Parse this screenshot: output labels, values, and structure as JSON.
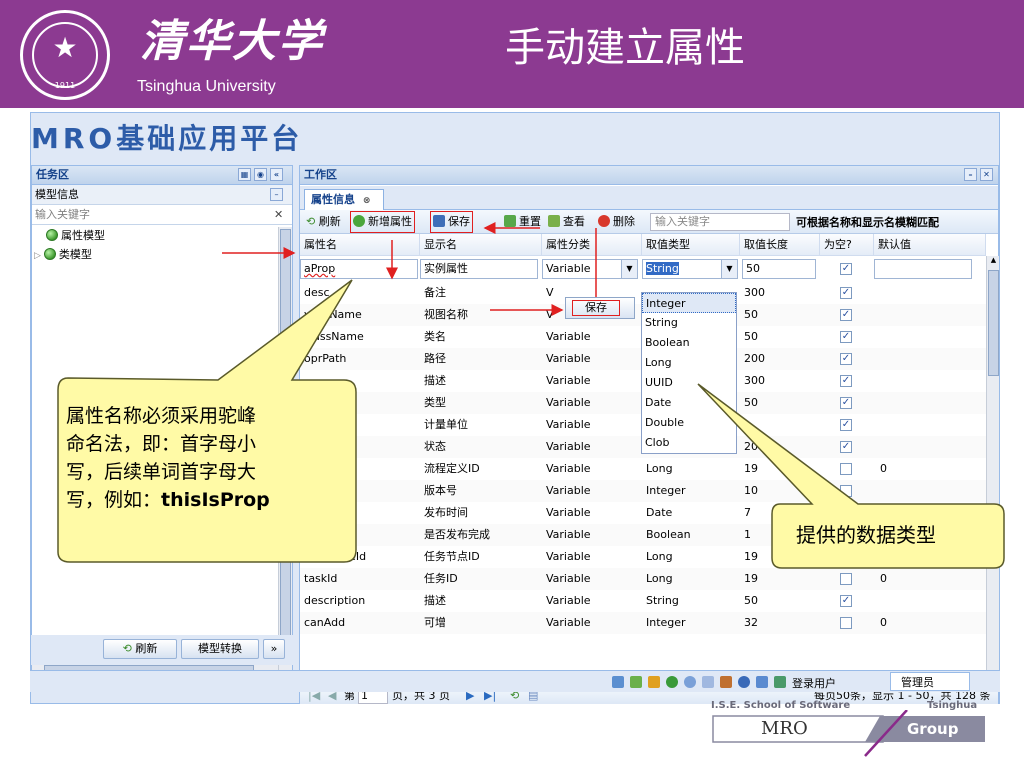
{
  "slide": {
    "university_cn": "清华大学",
    "university_en": "Tsinghua University",
    "title": "手动建立属性",
    "seal_year": "·1911·"
  },
  "app": {
    "logo_latin": "MRO",
    "logo_cn": "基础应用平台"
  },
  "left_panel": {
    "title": "任务区",
    "subtitle": "模型信息",
    "search_placeholder": "输入关键字",
    "tree": [
      {
        "label": "属性模型",
        "selected": true
      },
      {
        "label": "类模型",
        "selected": false
      }
    ],
    "refresh_label": "刷新",
    "convert_label": "模型转换",
    "more_label": "»"
  },
  "work_panel": {
    "title": "工作区",
    "tab_label": "属性信息",
    "toolbar": {
      "refresh": "刷新",
      "add": "新增属性",
      "save": "保存",
      "reset": "重置",
      "view": "查看",
      "delete": "删除",
      "search_placeholder": "输入关键字",
      "hint": "可根据名称和显示名模糊匹配"
    },
    "columns": [
      "属性名",
      "显示名",
      "属性分类",
      "取值类型",
      "取值长度",
      "为空?",
      "默认值"
    ],
    "edit_row": {
      "name": "aProp",
      "display": "实例属性",
      "category": "Variable",
      "type": "String",
      "length": "50",
      "nullable": true,
      "default": ""
    },
    "rows": [
      {
        "name": "desc",
        "display": "备注",
        "category": "V",
        "type": "",
        "length": "300",
        "nullable": true,
        "default": ""
      },
      {
        "name": "viewName",
        "display": "视图名称",
        "category": "V",
        "type": "",
        "length": "50",
        "nullable": true,
        "default": ""
      },
      {
        "name": "className",
        "display": "类名",
        "category": "Variable",
        "type": "",
        "length": "50",
        "nullable": true,
        "default": ""
      },
      {
        "name": "oprPath",
        "display": "路径",
        "category": "Variable",
        "type": "",
        "length": "200",
        "nullable": true,
        "default": ""
      },
      {
        "name": "",
        "display": "描述",
        "category": "Variable",
        "type": "",
        "length": "300",
        "nullable": true,
        "default": ""
      },
      {
        "name": "",
        "display": "类型",
        "category": "Variable",
        "type": "",
        "length": "50",
        "nullable": true,
        "default": ""
      },
      {
        "name": "",
        "display": "计量单位",
        "category": "Variable",
        "type": "",
        "length": "",
        "nullable": true,
        "default": ""
      },
      {
        "name": "",
        "display": "状态",
        "category": "Variable",
        "type": "String",
        "length": "20",
        "nullable": true,
        "default": ""
      },
      {
        "name": "…Id",
        "display": "流程定义ID",
        "category": "Variable",
        "type": "Long",
        "length": "19",
        "nullable": false,
        "default": "0"
      },
      {
        "name": "",
        "display": "版本号",
        "category": "Variable",
        "type": "Integer",
        "length": "10",
        "nullable": false,
        "default": ""
      },
      {
        "name": "…ate",
        "display": "发布时间",
        "category": "Variable",
        "type": "Date",
        "length": "7",
        "nullable": false,
        "default": ""
      },
      {
        "name": "…yCplt",
        "display": "是否发布完成",
        "category": "Variable",
        "type": "Boolean",
        "length": "1",
        "nullable": false,
        "default": ""
      },
      {
        "name": "taskNodeId",
        "display": "任务节点ID",
        "category": "Variable",
        "type": "Long",
        "length": "19",
        "nullable": false,
        "default": ""
      },
      {
        "name": "taskId",
        "display": "任务ID",
        "category": "Variable",
        "type": "Long",
        "length": "19",
        "nullable": false,
        "default": "0"
      },
      {
        "name": "description",
        "display": "描述",
        "category": "Variable",
        "type": "String",
        "length": "50",
        "nullable": true,
        "default": ""
      },
      {
        "name": "canAdd",
        "display": "可增",
        "category": "Variable",
        "type": "Integer",
        "length": "32",
        "nullable": false,
        "default": "0"
      }
    ],
    "pager": {
      "page_prefix": "第",
      "page": "1",
      "page_suffix": "页，共 3 页",
      "summary": "每页50条，显示 1 - 50，共 128 条"
    }
  },
  "type_dropdown": {
    "options": [
      "Integer",
      "String",
      "Boolean",
      "Long",
      "UUID",
      "Date",
      "Double",
      "Clob"
    ],
    "active": "Integer"
  },
  "save_popup": {
    "label": "保存"
  },
  "status_bar": {
    "user_label": "登录用户",
    "user_value": "管理员"
  },
  "annotations": {
    "left_callout": [
      "属性名称必须采用驼峰",
      "命名法，即：首字母小",
      "写，后续单词首字母大",
      "写，例如："
    ],
    "left_callout_example": "thisIsProp",
    "right_callout": "提供的数据类型"
  },
  "footer_logo": {
    "line1": "I.S.E. School of Software",
    "line1b": "Tsinghua",
    "mro": "MRO",
    "group": "Group"
  },
  "colors": {
    "brand_purple": "#8c3a91",
    "panel_blue": "#dfe8f6",
    "callout_yellow": "#fffaa6",
    "arrow_red": "#e02020"
  }
}
